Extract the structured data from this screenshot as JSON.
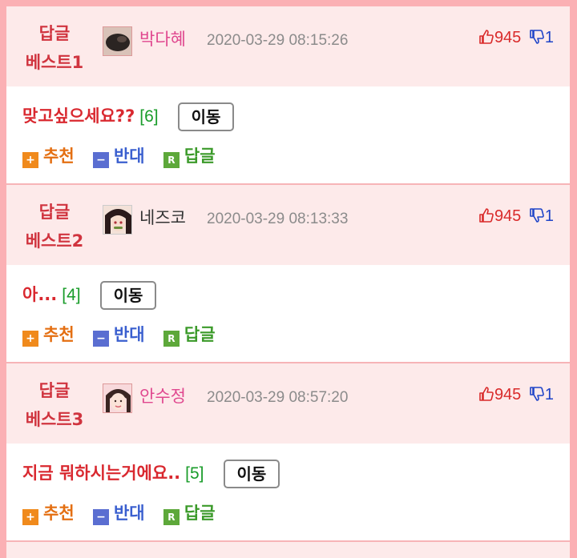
{
  "actions": {
    "recommend": "추천",
    "oppose": "반대",
    "reply": "답글",
    "move": "이동",
    "recommend_icon": "+",
    "oppose_icon": "−",
    "reply_icon": "R"
  },
  "replies": [
    {
      "label_line1": "답글",
      "label_line2": "베스트1",
      "nickname": "박다혜",
      "nick_color": "#e0488f",
      "datetime": "2020-03-29 08:15:26",
      "up": "945",
      "down": "1",
      "title": "맞고싶으세요??",
      "comment_count": "[6]",
      "avatar_icon": "dark-animal-avatar-icon"
    },
    {
      "label_line1": "답글",
      "label_line2": "베스트2",
      "nickname": "네즈코",
      "nick_color": "#333333",
      "datetime": "2020-03-29 08:13:33",
      "up": "945",
      "down": "1",
      "title": "아...",
      "comment_count": "[4]",
      "avatar_icon": "anime-girl-avatar-icon"
    },
    {
      "label_line1": "답글",
      "label_line2": "베스트3",
      "nickname": "안수정",
      "nick_color": "#e0488f",
      "datetime": "2020-03-29 08:57:20",
      "up": "945",
      "down": "1",
      "title": "지금 뭐하시는거에요..",
      "comment_count": "[5]",
      "avatar_icon": "girl-photo-avatar-icon"
    }
  ]
}
